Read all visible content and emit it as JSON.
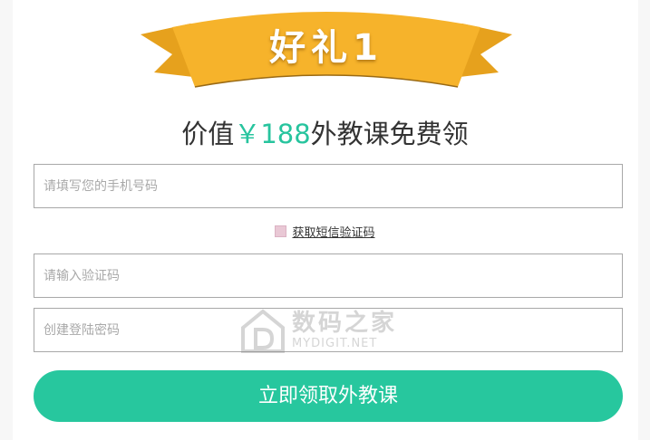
{
  "banner": {
    "title": "好礼1"
  },
  "headline": {
    "prefix": "价值",
    "price": "￥188",
    "suffix": "外教课免费领"
  },
  "form": {
    "phone_placeholder": "请填写您的手机号码",
    "sms_link": "获取短信验证码",
    "code_placeholder": "请输入验证码",
    "password_placeholder": "创建登陆密码",
    "submit_label": "立即领取外教课"
  },
  "watermark": {
    "name": "数码之家",
    "site": "MYDIGIT.NET",
    "icon": "house-d-icon"
  },
  "colors": {
    "accent": "#27c79e",
    "ribbon": "#f6b32b",
    "checkbox": "#e9c8d5"
  }
}
